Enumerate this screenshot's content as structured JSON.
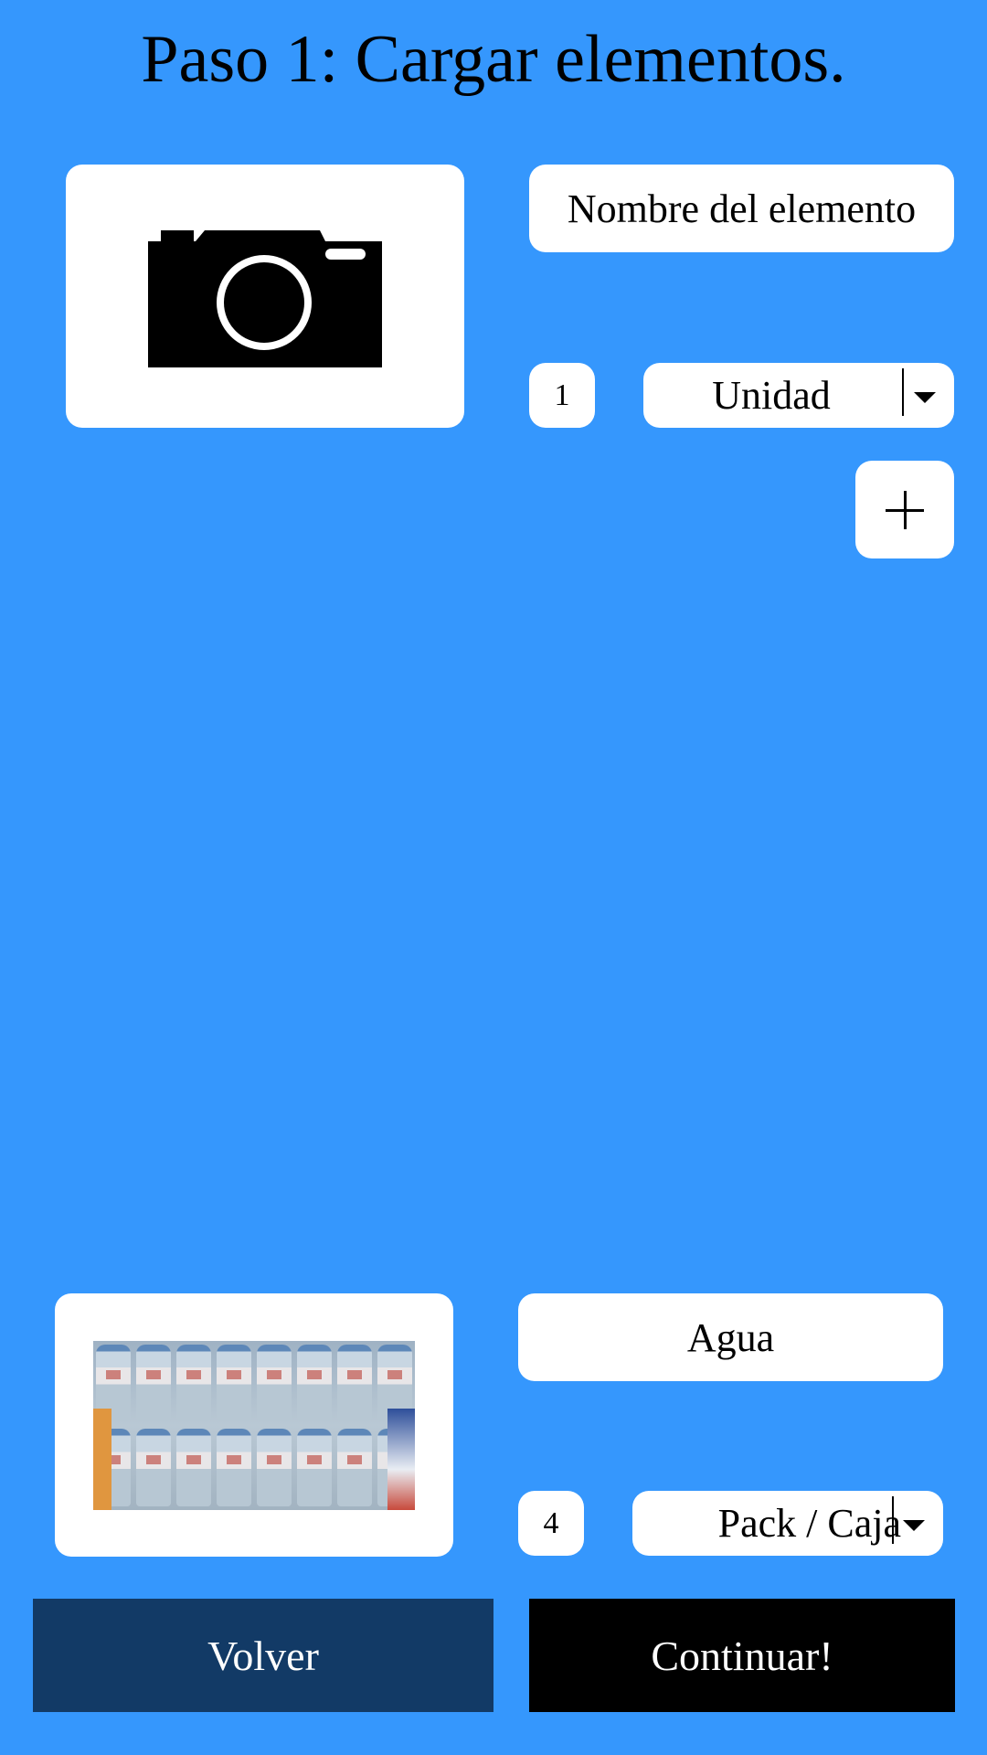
{
  "header": {
    "title": "Paso 1: Cargar elementos."
  },
  "new_item": {
    "photo_icon": "camera-icon",
    "name_placeholder": "Nombre del elemento",
    "quantity": "1",
    "unit": "Unidad",
    "add_icon": "plus-icon"
  },
  "added_item": {
    "photo": "water-bottles-pack-photo",
    "name": "Agua",
    "quantity": "4",
    "unit": "Pack / Caja"
  },
  "footer": {
    "back_label": "Volver",
    "continue_label": "Continuar!"
  },
  "colors": {
    "background": "#3597FD",
    "back_button": "#123A66",
    "continue_button": "#000000",
    "card": "#FFFFFF"
  }
}
